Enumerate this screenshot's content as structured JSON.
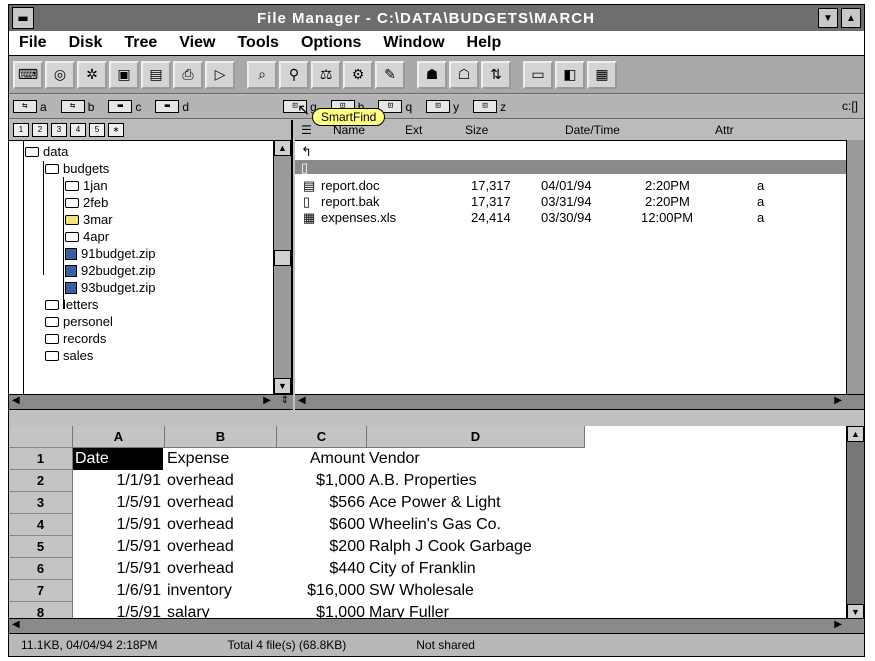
{
  "window": {
    "title": "File Manager - C:\\DATA\\BUDGETS\\MARCH"
  },
  "menus": [
    "File",
    "Disk",
    "Tree",
    "View",
    "Tools",
    "Options",
    "Window",
    "Help"
  ],
  "toolbar": {
    "tooltip": "SmartFind"
  },
  "drives": [
    "a",
    "b",
    "c",
    "d",
    "g",
    "h",
    "q",
    "y",
    "z"
  ],
  "drive_path": "c:[]",
  "tree": {
    "items": [
      {
        "label": "data",
        "level": 0
      },
      {
        "label": "budgets",
        "level": 1
      },
      {
        "label": "1jan",
        "level": 2
      },
      {
        "label": "2feb",
        "level": 2
      },
      {
        "label": "3mar",
        "level": 2
      },
      {
        "label": "4apr",
        "level": 2
      },
      {
        "label": "91budget.zip",
        "level": 2
      },
      {
        "label": "92budget.zip",
        "level": 2
      },
      {
        "label": "93budget.zip",
        "level": 2
      },
      {
        "label": "letters",
        "level": 1
      },
      {
        "label": "personel",
        "level": 1
      },
      {
        "label": "records",
        "level": 1
      },
      {
        "label": "sales",
        "level": 1
      }
    ]
  },
  "files": {
    "headers": {
      "name": "Name",
      "ext": "Ext",
      "size": "Size",
      "datetime": "Date/Time",
      "attr": "Attr"
    },
    "rows": [
      {
        "name": "report.doc",
        "size": "17,317",
        "date": "04/01/94",
        "time": "2:20PM",
        "attr": "a"
      },
      {
        "name": "report.bak",
        "size": "17,317",
        "date": "03/31/94",
        "time": "2:20PM",
        "attr": "a"
      },
      {
        "name": "expenses.xls",
        "size": "24,414",
        "date": "03/30/94",
        "time": "12:00PM",
        "attr": "a"
      }
    ]
  },
  "sheet": {
    "columns": [
      "A",
      "B",
      "C",
      "D"
    ],
    "rows": [
      {
        "num": "1",
        "a": "Date",
        "b": "Expense",
        "c": "Amount",
        "d": "Vendor"
      },
      {
        "num": "2",
        "a": "1/1/91",
        "b": "overhead",
        "c": "$1,000",
        "d": "A.B. Properties"
      },
      {
        "num": "3",
        "a": "1/5/91",
        "b": "overhead",
        "c": "$566",
        "d": "Ace Power & Light"
      },
      {
        "num": "4",
        "a": "1/5/91",
        "b": "overhead",
        "c": "$600",
        "d": "Wheelin's Gas Co."
      },
      {
        "num": "5",
        "a": "1/5/91",
        "b": "overhead",
        "c": "$200",
        "d": "Ralph J Cook Garbage"
      },
      {
        "num": "6",
        "a": "1/5/91",
        "b": "overhead",
        "c": "$440",
        "d": "City of Franklin"
      },
      {
        "num": "7",
        "a": "1/6/91",
        "b": "inventory",
        "c": "$16,000",
        "d": "SW Wholesale"
      },
      {
        "num": "8",
        "a": "1/5/91",
        "b": "salary",
        "c": "$1,000",
        "d": "Mary Fuller"
      }
    ]
  },
  "status": {
    "selected": "11.1KB, 04/04/94 2:18PM",
    "total": "Total 4 file(s) (68.8KB)",
    "shared": "Not shared"
  }
}
